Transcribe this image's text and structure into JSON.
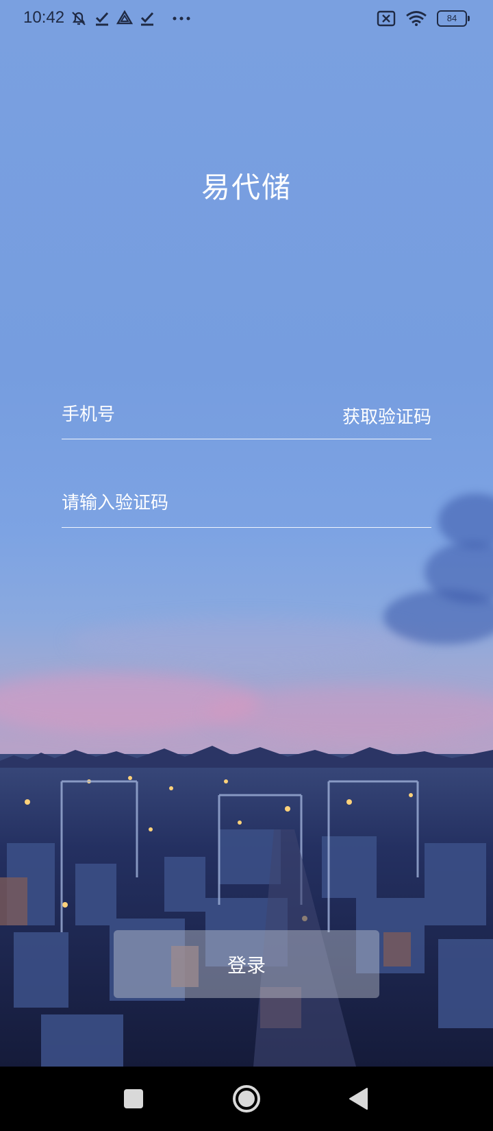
{
  "status_bar": {
    "time": "10:42",
    "battery": "84",
    "left_icons": [
      "silent-mode-icon",
      "check-icon",
      "drive-icon",
      "check-icon",
      "more-dots-icon"
    ],
    "right_icons": [
      "sim-off-icon",
      "wifi-icon",
      "battery-icon"
    ]
  },
  "app": {
    "title": "易代储"
  },
  "form": {
    "phone_placeholder": "手机号",
    "get_code_label": "获取验证码",
    "code_placeholder": "请输入验证码",
    "login_label": "登录"
  },
  "nav_bar": {
    "buttons": [
      "recent-apps-icon",
      "home-icon",
      "back-icon"
    ]
  },
  "colors": {
    "sky_top": "#7aa0e0",
    "text": "#ffffff",
    "status_text": "#1f2a44",
    "nav_bg": "#000000"
  }
}
